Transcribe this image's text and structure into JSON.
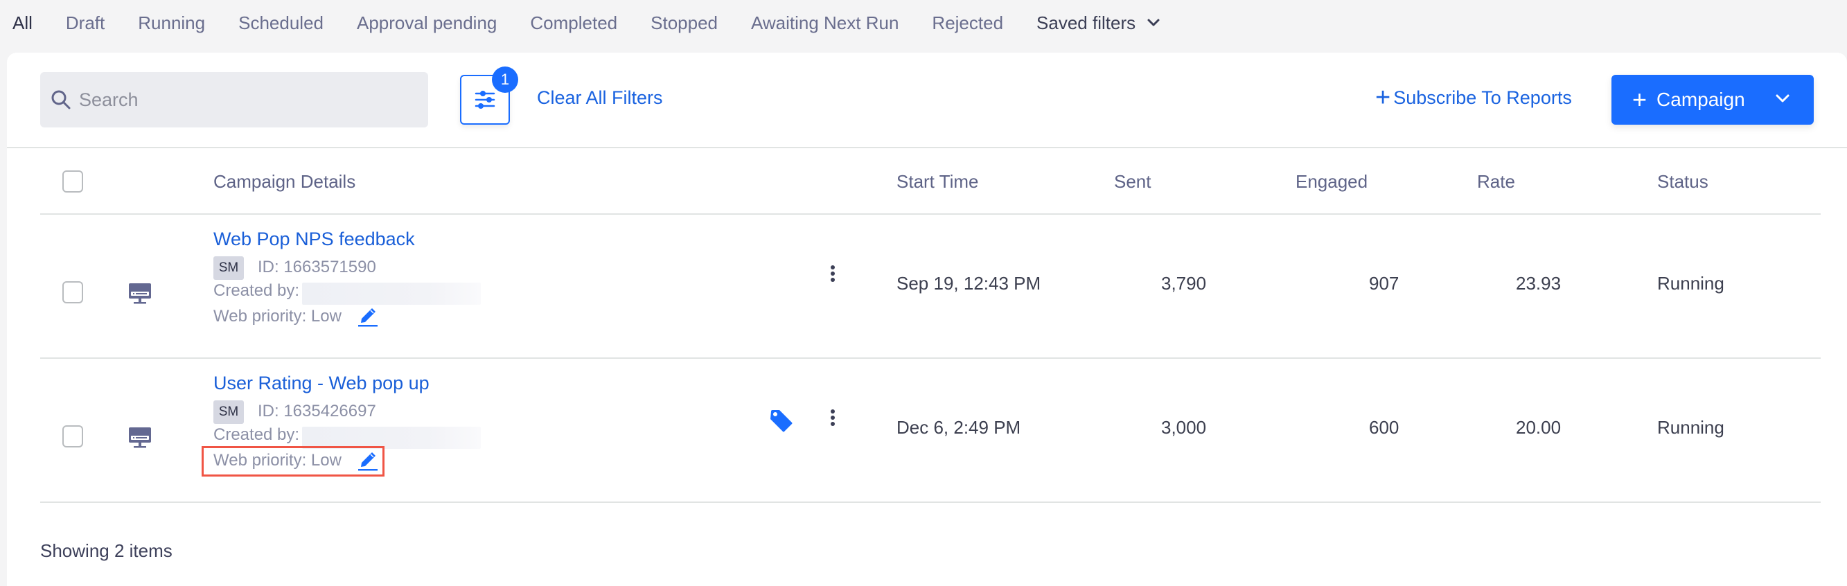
{
  "tabs": {
    "items": [
      "All",
      "Draft",
      "Running",
      "Scheduled",
      "Approval pending",
      "Completed",
      "Stopped",
      "Awaiting Next Run",
      "Rejected"
    ],
    "active": "All",
    "saved_filters_label": "Saved filters"
  },
  "toolbar": {
    "search_placeholder": "Search",
    "search_value": "",
    "filter_count": "1",
    "clear_filters_label": "Clear All Filters",
    "subscribe_label": "Subscribe To Reports",
    "campaign_button_label": "Campaign"
  },
  "table": {
    "columns": {
      "campaign_details": "Campaign Details",
      "start_time": "Start Time",
      "sent": "Sent",
      "engaged": "Engaged",
      "rate": "Rate",
      "status": "Status"
    },
    "rows": [
      {
        "name": "Web Pop NPS feedback",
        "channel_badge": "SM",
        "id_text": "ID: 1663571590",
        "created_by_label": "Created by:",
        "priority_text": "Web priority: Low",
        "has_tag": false,
        "highlighted": false,
        "start_time": "Sep 19, 12:43 PM",
        "sent": "3,790",
        "engaged": "907",
        "rate": "23.93",
        "status": "Running"
      },
      {
        "name": "User Rating - Web pop up",
        "channel_badge": "SM",
        "id_text": "ID: 1635426697",
        "created_by_label": "Created by:",
        "priority_text": "Web priority: Low",
        "has_tag": true,
        "highlighted": true,
        "start_time": "Dec 6, 2:49 PM",
        "sent": "3,000",
        "engaged": "600",
        "rate": "20.00",
        "status": "Running"
      }
    ]
  },
  "footer": {
    "summary": "Showing 2 items"
  },
  "colors": {
    "accent": "#1a6dff",
    "link": "#1a5fd8",
    "highlight_border": "#f05545",
    "muted_text": "#8c90a6"
  }
}
